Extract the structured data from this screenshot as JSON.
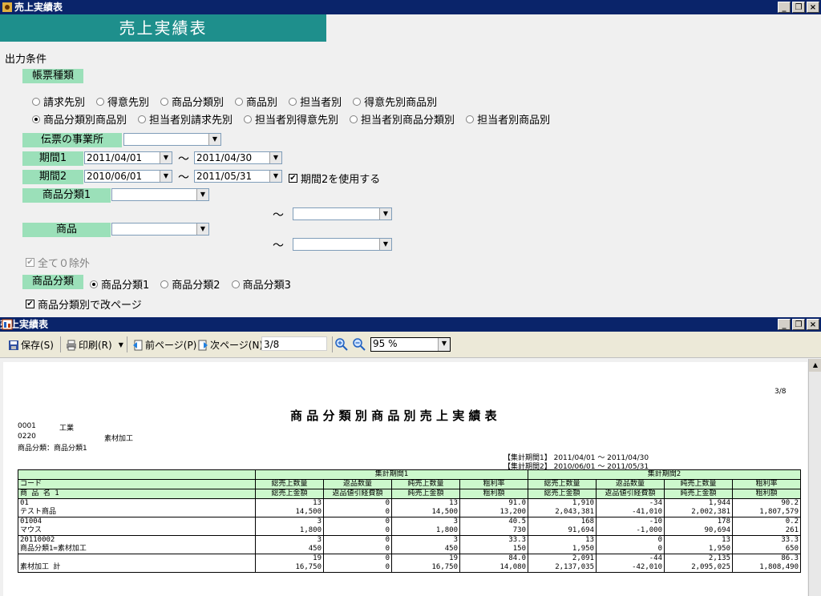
{
  "window": {
    "title": "売上実績表"
  },
  "banner": {
    "title": "売上実績表"
  },
  "conditions": {
    "section_label": "出力条件",
    "report_type_label": "帳票種類",
    "report_types_row1": [
      "請求先別",
      "得意先別",
      "商品分類別",
      "商品別",
      "担当者別",
      "得意先別商品別"
    ],
    "report_types_row2": [
      "商品分類別商品別",
      "担当者別請求先別",
      "担当者別得意先別",
      "担当者別商品分類別",
      "担当者別商品別"
    ],
    "selected_report_type": "商品分類別商品別",
    "office_label": "伝票の事業所",
    "office_value": "",
    "period1_label": "期間1",
    "period1_from": "2011/04/01",
    "period1_to": "2011/04/30",
    "period2_label": "期間2",
    "period2_from": "2010/06/01",
    "period2_to": "2011/05/31",
    "use_period2_label": "期間2を使用する",
    "use_period2_checked": true,
    "product_category1_label": "商品分類1",
    "product_label": "商品",
    "tilde": "～",
    "exclude_zero_label": "全て０除外",
    "category_label": "商品分類",
    "category_options": [
      "商品分類1",
      "商品分類2",
      "商品分類3"
    ],
    "selected_category": "商品分類1",
    "page_break_label": "商品分類別で改ページ"
  },
  "viewer": {
    "title": "売上実績表",
    "save_label": "保存(S)",
    "print_label": "印刷(R)",
    "prev_label": "前ページ(P)",
    "next_label": "次ページ(N)",
    "page_indicator": "3/8",
    "zoom_value": "95 %"
  },
  "report": {
    "page_no": "3/8",
    "title": "商 品 分 類 別 商 品 別 売 上 実 績 表",
    "line1_code": "0001",
    "line1_name": "工業",
    "line2_code": "0220",
    "line2_name": "素材加工",
    "line3": "商品分類：商品分類1",
    "period1_caption": "【集計期間1】 2011/04/01 ～ 2011/04/30",
    "period2_caption": "【集計期間2】 2010/06/01 ～ 2011/05/31",
    "header": {
      "code": "コード",
      "name": "商 品 名 1",
      "period1": "集計期間1",
      "period2": "集計期間2",
      "sub_top": [
        "総売上数量",
        "返品数量",
        "純売上数量",
        "粗利率"
      ],
      "sub_bottom": [
        "総売上金額",
        "返品値引経費額",
        "純売上金額",
        "粗利額"
      ]
    },
    "rows": [
      {
        "code": "01",
        "name": "テスト商品",
        "top": [
          "13",
          "0",
          "13",
          "91.0",
          "1,910",
          "-34",
          "1,944",
          "90.2"
        ],
        "bottom": [
          "14,500",
          "0",
          "14,500",
          "13,200",
          "2,043,381",
          "-41,010",
          "2,002,381",
          "1,807,579"
        ]
      },
      {
        "code": "01004",
        "name": "マウス",
        "top": [
          "3",
          "0",
          "3",
          "40.5",
          "168",
          "-10",
          "178",
          "0.2"
        ],
        "bottom": [
          "1,800",
          "0",
          "1,800",
          "730",
          "91,694",
          "-1,000",
          "90,694",
          "261"
        ]
      },
      {
        "code": "20110002",
        "name": "商品分類1=素材加工",
        "top": [
          "3",
          "0",
          "3",
          "33.3",
          "13",
          "0",
          "13",
          "33.3"
        ],
        "bottom": [
          "450",
          "0",
          "450",
          "150",
          "1,950",
          "0",
          "1,950",
          "650"
        ]
      },
      {
        "code": "",
        "name": "素材加工 計",
        "top": [
          "19",
          "0",
          "19",
          "84.0",
          "2,091",
          "-44",
          "2,135",
          "86.3"
        ],
        "bottom": [
          "16,750",
          "0",
          "16,750",
          "14,080",
          "2,137,035",
          "-42,010",
          "2,095,025",
          "1,808,490"
        ]
      }
    ]
  }
}
